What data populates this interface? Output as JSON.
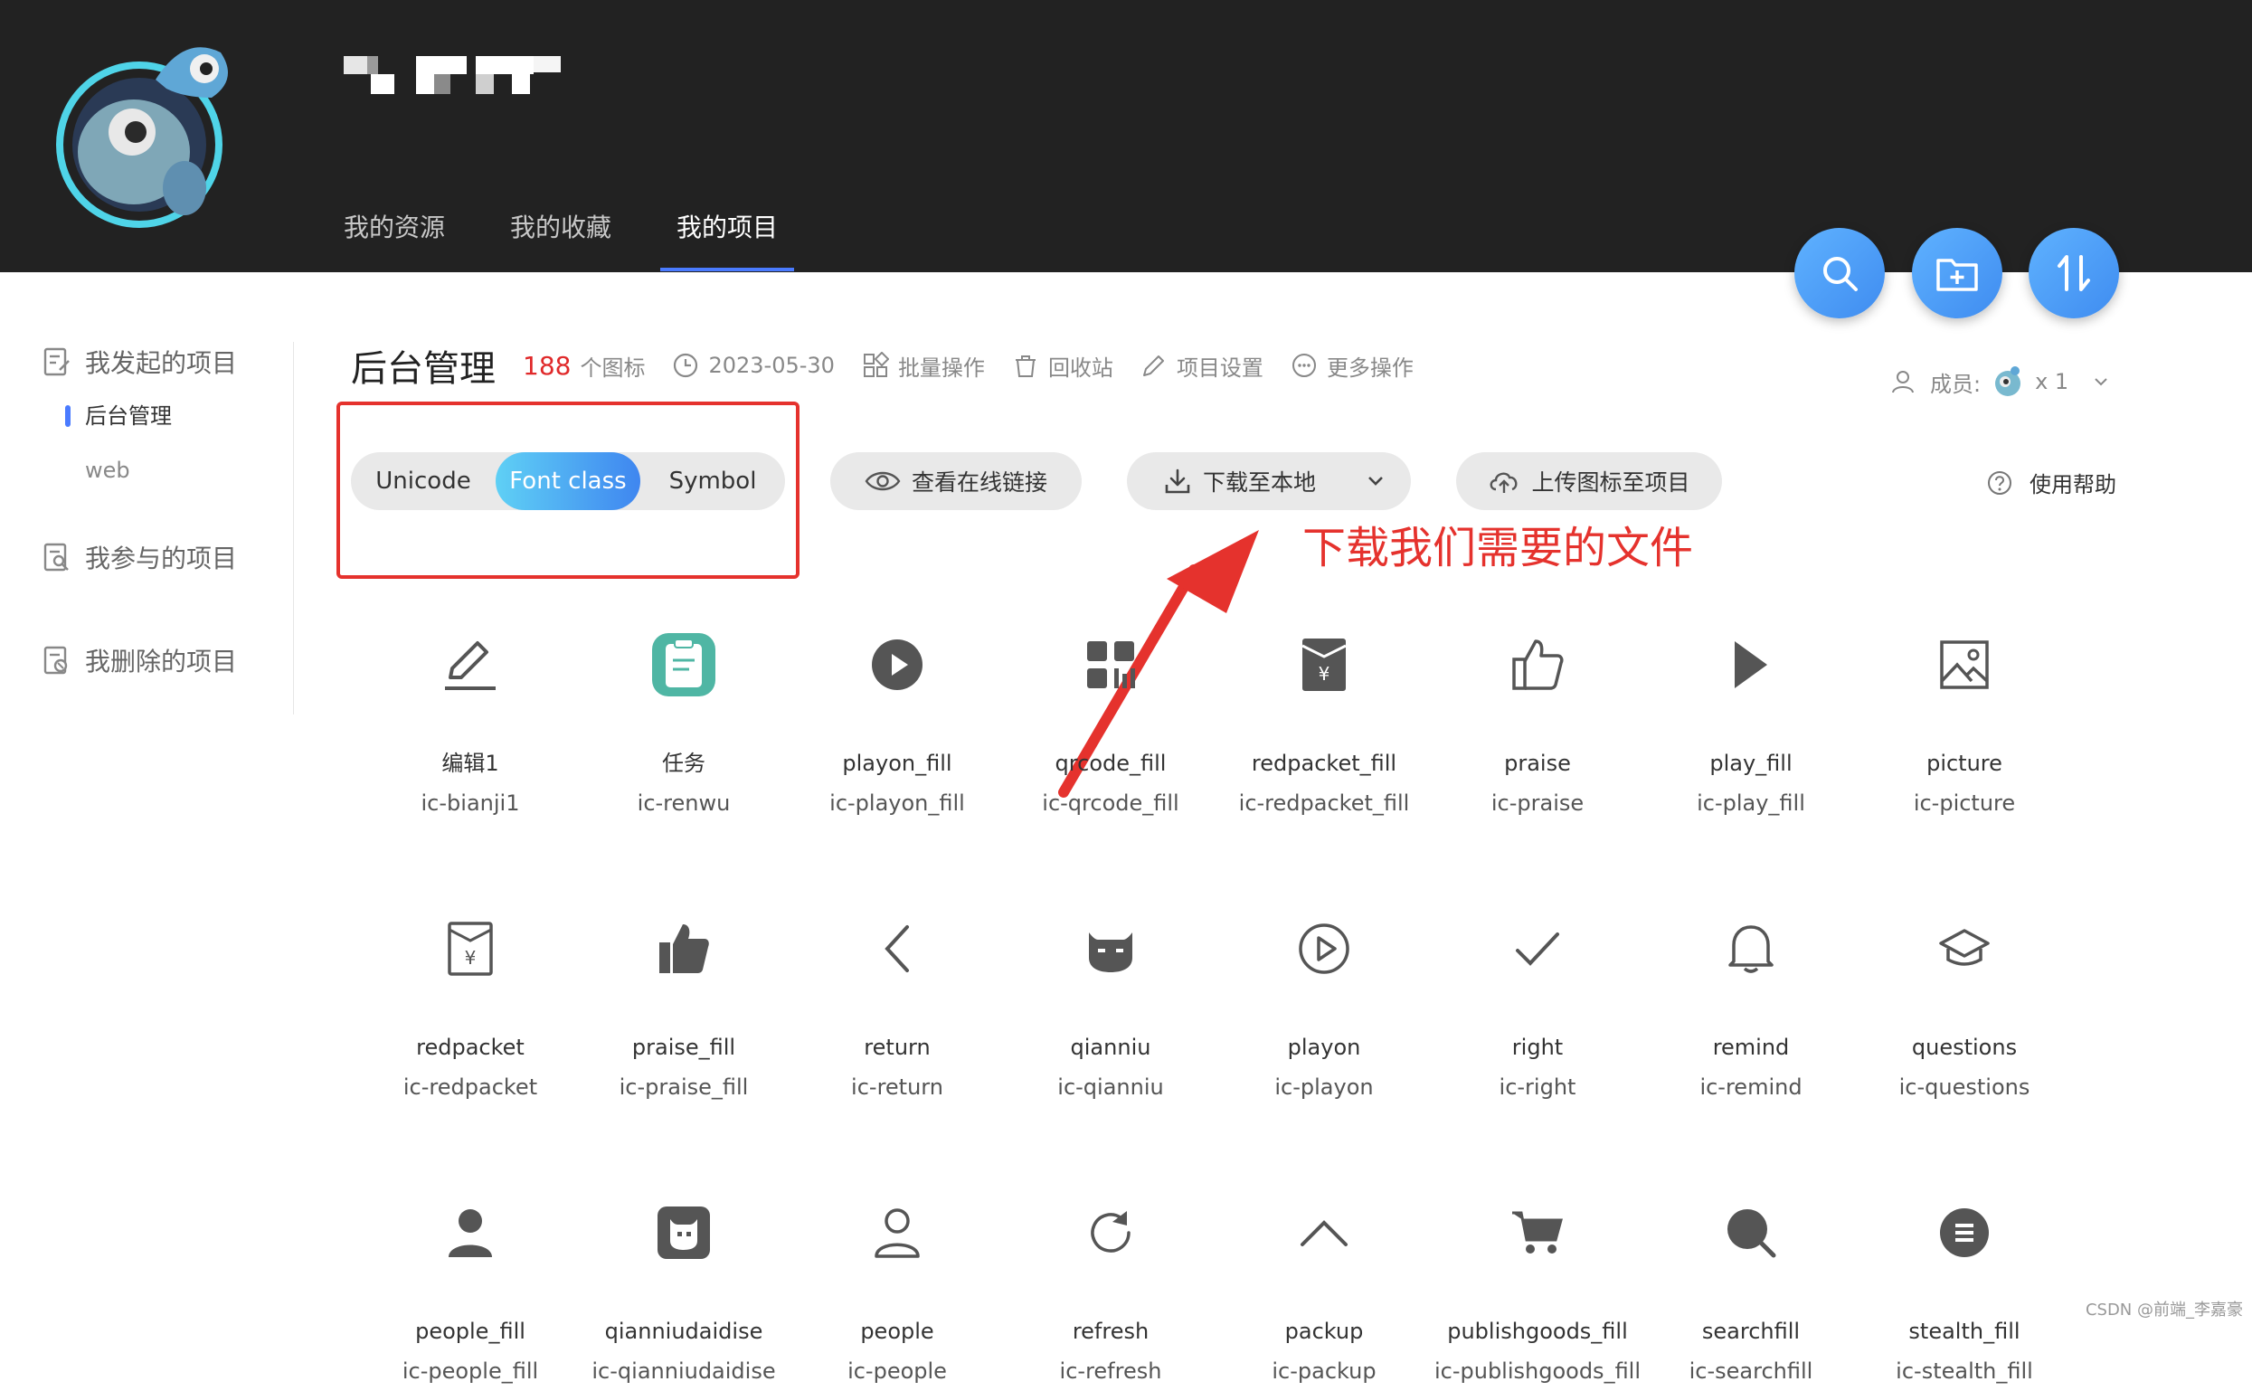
{
  "header": {
    "nav": [
      "我的资源",
      "我的收藏",
      "我的项目"
    ],
    "active_nav": 2
  },
  "sidebar": {
    "started_label": "我发起的项目",
    "projects": [
      "后台管理",
      "web"
    ],
    "joined_label": "我参与的项目",
    "deleted_label": "我删除的项目"
  },
  "project": {
    "title": "后台管理",
    "count": "188",
    "count_unit": "个图标",
    "date": "2023-05-30",
    "batch": "批量操作",
    "recycle": "回收站",
    "settings": "项目设置",
    "more": "更多操作",
    "members_label": "成员:",
    "members_count": "x 1"
  },
  "toolbar": {
    "seg": [
      "Unicode",
      "Font class",
      "Symbol"
    ],
    "active_seg": 1,
    "view_link": "查看在线链接",
    "download": "下载至本地",
    "upload": "上传图标至项目",
    "help": "使用帮助"
  },
  "annotation": "下载我们需要的文件",
  "icons": [
    {
      "name": "编辑1",
      "cls": "ic-bianji1",
      "icon": "edit-icon"
    },
    {
      "name": "任务",
      "cls": "ic-renwu",
      "icon": "task-icon"
    },
    {
      "name": "playon_fill",
      "cls": "ic-playon_fill",
      "icon": "playon-fill-icon"
    },
    {
      "name": "qrcode_fill",
      "cls": "ic-qrcode_fill",
      "icon": "qrcode-fill-icon"
    },
    {
      "name": "redpacket_fill",
      "cls": "ic-redpacket_fill",
      "icon": "redpacket-fill-icon"
    },
    {
      "name": "praise",
      "cls": "ic-praise",
      "icon": "praise-icon"
    },
    {
      "name": "play_fill",
      "cls": "ic-play_fill",
      "icon": "play-fill-icon"
    },
    {
      "name": "picture",
      "cls": "ic-picture",
      "icon": "picture-icon"
    },
    {
      "name": "redpacket",
      "cls": "ic-redpacket",
      "icon": "redpacket-icon"
    },
    {
      "name": "praise_fill",
      "cls": "ic-praise_fill",
      "icon": "praise-fill-icon"
    },
    {
      "name": "return",
      "cls": "ic-return",
      "icon": "return-icon"
    },
    {
      "name": "qianniu",
      "cls": "ic-qianniu",
      "icon": "qianniu-icon"
    },
    {
      "name": "playon",
      "cls": "ic-playon",
      "icon": "playon-icon"
    },
    {
      "name": "right",
      "cls": "ic-right",
      "icon": "right-icon"
    },
    {
      "name": "remind",
      "cls": "ic-remind",
      "icon": "remind-icon"
    },
    {
      "name": "questions",
      "cls": "ic-questions",
      "icon": "questions-icon"
    },
    {
      "name": "people_fill",
      "cls": "ic-people_fill",
      "icon": "people-fill-icon"
    },
    {
      "name": "qianniudaidise",
      "cls": "ic-qianniudaidise",
      "icon": "qianniudaidise-icon"
    },
    {
      "name": "people",
      "cls": "ic-people",
      "icon": "people-icon"
    },
    {
      "name": "refresh",
      "cls": "ic-refresh",
      "icon": "refresh-icon"
    },
    {
      "name": "packup",
      "cls": "ic-packup",
      "icon": "packup-icon"
    },
    {
      "name": "publishgoods_fill",
      "cls": "ic-publishgoods_fill",
      "icon": "cart-icon"
    },
    {
      "name": "searchfill",
      "cls": "ic-searchfill",
      "icon": "searchfill-icon"
    },
    {
      "name": "stealth_fill",
      "cls": "ic-stealth_fill",
      "icon": "stealth-fill-icon"
    }
  ],
  "watermark": "CSDN @前端_李嘉豪",
  "colors": {
    "accent": "#4a7bff",
    "count": "#e0292a",
    "annotation": "#e5322d",
    "icon": "#666666",
    "header": "#222222"
  }
}
